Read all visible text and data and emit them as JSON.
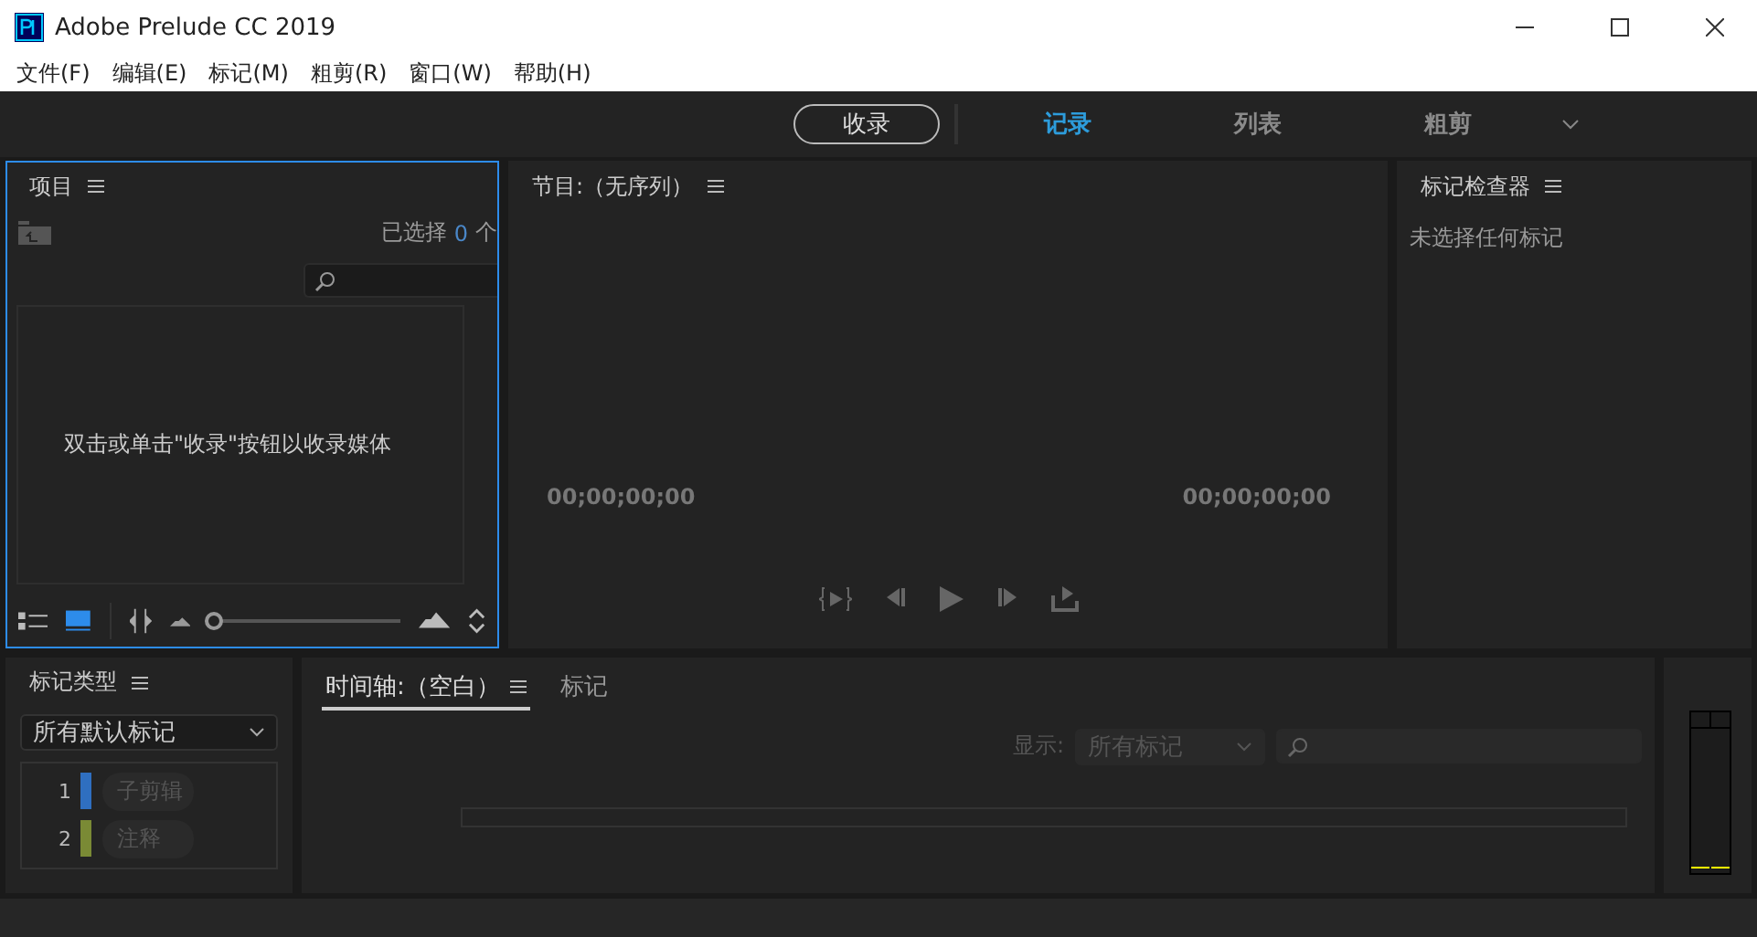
{
  "window": {
    "title": "Adobe Prelude CC 2019"
  },
  "menu": [
    "文件(F)",
    "编辑(E)",
    "标记(M)",
    "粗剪(R)",
    "窗口(W)",
    "帮助(H)"
  ],
  "workspace": {
    "ingest_button": "收录",
    "tabs": [
      {
        "label": "记录",
        "selected": true
      },
      {
        "label": "列表",
        "selected": false
      },
      {
        "label": "粗剪",
        "selected": false
      }
    ]
  },
  "project_panel": {
    "title": "项目",
    "selected_count": "已选择",
    "count": "0",
    "count_unit": "个",
    "empty_message": "双击或单击\"收录\"按钮以收录媒体",
    "zoom": {
      "level": 0.02
    },
    "selected": true
  },
  "program_panel": {
    "title": "节目:（无序列）",
    "timecode_left": "00;00;00;00",
    "timecode_right": "00;00;00;00"
  },
  "marker_inspector": {
    "title": "标记检查器",
    "empty_message": "未选择任何标记"
  },
  "marker_types": {
    "title": "标记类型",
    "filter": "所有默认标记",
    "items": [
      {
        "number": "1",
        "label": "子剪辑",
        "color": "#2f6fc0"
      },
      {
        "number": "2",
        "label": "注释",
        "color": "#7a8a35"
      }
    ]
  },
  "timeline": {
    "tabs": [
      {
        "label": "时间轴:（空白）",
        "selected": true
      },
      {
        "label": "标记",
        "selected": false
      }
    ],
    "show_label": "显示:",
    "show_filter": "所有标记"
  }
}
